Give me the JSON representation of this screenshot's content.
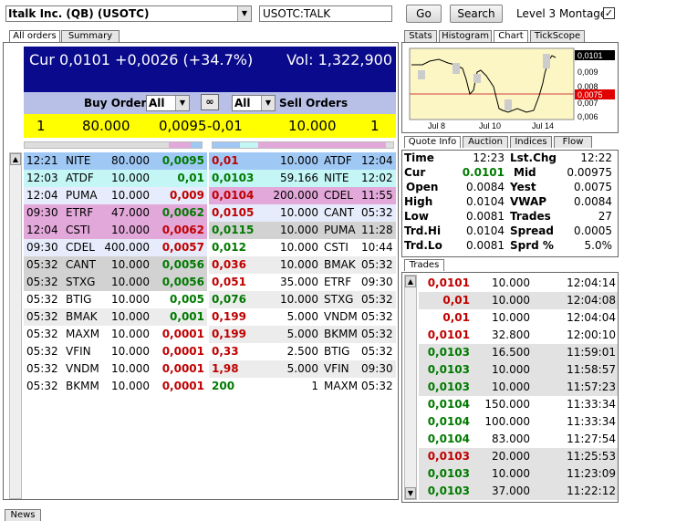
{
  "toolbar": {
    "symbol_combo": "Italk Inc. (QB) (USOTC)",
    "symbol_input": "USOTC:TALK",
    "go_label": "Go",
    "search_label": "Search",
    "level3_label": "Level 3 Montage",
    "level3_checked": "✓"
  },
  "left_tabs": {
    "all_orders": "All orders",
    "summary": "Summary"
  },
  "header": {
    "cur": "Cur 0,0101 +0,0026 (+34.7%)",
    "vol": "Vol: 1,322,900"
  },
  "order_bar": {
    "buy_label": "Buy Orders",
    "buy_filter": "All",
    "sell_filter": "All",
    "sell_label": "Sell Orders"
  },
  "best": {
    "bid_count": "1",
    "bid_size": "80.000",
    "bid_price": "0,0095",
    "ask_price": "-0,01",
    "ask_size": "10.000",
    "ask_count": "1"
  },
  "orders": [
    {
      "bt": "12:21",
      "bm": "NITE",
      "bs": "80.000",
      "bp": "0,0095",
      "bpc": "grn",
      "ap": "0,01",
      "apc": "red",
      "as": "10.000",
      "am": "ATDF",
      "at": "12:04",
      "bbg": "#9fc8f5",
      "abg": "#9fc8f5"
    },
    {
      "bt": "12:03",
      "bm": "ATDF",
      "bs": "10.000",
      "bp": "0,01",
      "bpc": "grn",
      "ap": "0,0103",
      "apc": "grn",
      "as": "59.166",
      "am": "NITE",
      "at": "12:02",
      "bbg": "#c4f6f6",
      "abg": "#c4f6f6"
    },
    {
      "bt": "12:04",
      "bm": "PUMA",
      "bs": "10.000",
      "bp": "0,009",
      "bpc": "red",
      "ap": "0,0104",
      "apc": "red",
      "as": "200.000",
      "am": "CDEL",
      "at": "11:55",
      "bbg": "#e6ecfb",
      "abg": "#e3a8da"
    },
    {
      "bt": "09:30",
      "bm": "ETRF",
      "bs": "47.000",
      "bp": "0,0062",
      "bpc": "grn",
      "ap": "0,0105",
      "apc": "red",
      "as": "10.000",
      "am": "CANT",
      "at": "05:32",
      "bbg": "#e3a8da",
      "abg": "#e6ecfb"
    },
    {
      "bt": "12:04",
      "bm": "CSTI",
      "bs": "10.000",
      "bp": "0,0062",
      "bpc": "red",
      "ap": "0,0115",
      "apc": "grn",
      "as": "10.000",
      "am": "PUMA",
      "at": "11:28",
      "bbg": "#e3a8da",
      "abg": "#d2d2d2"
    },
    {
      "bt": "09:30",
      "bm": "CDEL",
      "bs": "400.000",
      "bp": "0,0057",
      "bpc": "red",
      "ap": "0,012",
      "apc": "grn",
      "as": "10.000",
      "am": "CSTI",
      "at": "10:44",
      "bbg": "#e6ecfb",
      "abg": "#ffffff"
    },
    {
      "bt": "05:32",
      "bm": "CANT",
      "bs": "10.000",
      "bp": "0,0056",
      "bpc": "grn",
      "ap": "0,036",
      "apc": "red",
      "as": "10.000",
      "am": "BMAK",
      "at": "05:32",
      "bbg": "#d2d2d2",
      "abg": "#ececec"
    },
    {
      "bt": "05:32",
      "bm": "STXG",
      "bs": "10.000",
      "bp": "0,0056",
      "bpc": "grn",
      "ap": "0,051",
      "apc": "red",
      "as": "35.000",
      "am": "ETRF",
      "at": "09:30",
      "bbg": "#d2d2d2",
      "abg": "#ffffff"
    },
    {
      "bt": "05:32",
      "bm": "BTIG",
      "bs": "10.000",
      "bp": "0,005",
      "bpc": "grn",
      "ap": "0,076",
      "apc": "grn",
      "as": "10.000",
      "am": "STXG",
      "at": "05:32",
      "bbg": "#ffffff",
      "abg": "#ececec"
    },
    {
      "bt": "05:32",
      "bm": "BMAK",
      "bs": "10.000",
      "bp": "0,001",
      "bpc": "grn",
      "ap": "0,199",
      "apc": "red",
      "as": "5.000",
      "am": "VNDM",
      "at": "05:32",
      "bbg": "#ececec",
      "abg": "#ffffff"
    },
    {
      "bt": "05:32",
      "bm": "MAXM",
      "bs": "10.000",
      "bp": "0,0001",
      "bpc": "red",
      "ap": "0,199",
      "apc": "red",
      "as": "5.000",
      "am": "BKMM",
      "at": "05:32",
      "bbg": "#ffffff",
      "abg": "#ececec"
    },
    {
      "bt": "05:32",
      "bm": "VFIN",
      "bs": "10.000",
      "bp": "0,0001",
      "bpc": "red",
      "ap": "0,33",
      "apc": "red",
      "as": "2.500",
      "am": "BTIG",
      "at": "05:32",
      "bbg": "#ffffff",
      "abg": "#ffffff"
    },
    {
      "bt": "05:32",
      "bm": "VNDM",
      "bs": "10.000",
      "bp": "0,0001",
      "bpc": "red",
      "ap": "1,98",
      "apc": "red",
      "as": "5.000",
      "am": "VFIN",
      "at": "09:30",
      "bbg": "#ffffff",
      "abg": "#ececec"
    },
    {
      "bt": "05:32",
      "bm": "BKMM",
      "bs": "10.000",
      "bp": "0,0001",
      "bpc": "red",
      "ap": "200",
      "apc": "grn",
      "as": "1",
      "am": "MAXM",
      "at": "05:32",
      "bbg": "#ffffff",
      "abg": "#ffffff"
    }
  ],
  "right_tabs": {
    "stats": "Stats",
    "histogram": "Histogram",
    "chart": "Chart",
    "tickscope": "TickScope"
  },
  "chart": {
    "price_labels": [
      "0,0101",
      "0,009",
      "0,008",
      "0,0075",
      "0,007",
      "0,006"
    ],
    "x_labels": [
      "Jul 8",
      "Jul 10",
      "Jul 14"
    ]
  },
  "quote_tabs": {
    "quote_info": "Quote Info",
    "auction": "Auction",
    "indices": "Indices",
    "flow": "Flow"
  },
  "quote": {
    "time_l": "Time",
    "time_v": "12:23",
    "lstchg_l": "Lst.Chg",
    "lstchg_v": "12:22",
    "cur_l": "Cur",
    "cur_v": "0.0101",
    "mid_l": "Mid",
    "mid_v": "0.00975",
    "open_l": "Open",
    "open_v": "0.0084",
    "yest_l": "Yest",
    "yest_v": "0.0075",
    "high_l": "High",
    "high_v": "0.0104",
    "vwap_l": "VWAP",
    "vwap_v": "0.0084",
    "low_l": "Low",
    "low_v": "0.0081",
    "trades_l": "Trades",
    "trades_v": "27",
    "trdhi_l": "Trd.Hi",
    "trdhi_v": "0.0104",
    "spread_l": "Spread",
    "spread_v": "0.0005",
    "trdlo_l": "Trd.Lo",
    "trdlo_v": "0.0081",
    "sprd_l": "Sprd %",
    "sprd_v": "5.0%"
  },
  "trades_tab": "Trades",
  "trades": [
    {
      "p": "0,0101",
      "c": "red",
      "s": "10.000",
      "t": "12:04:14",
      "bg": "#ffffff"
    },
    {
      "p": "0,01",
      "c": "red",
      "s": "10.000",
      "t": "12:04:08",
      "bg": "#e2e2e2"
    },
    {
      "p": "0,01",
      "c": "red",
      "s": "10.000",
      "t": "12:04:04",
      "bg": "#ffffff"
    },
    {
      "p": "0,0101",
      "c": "red",
      "s": "32.800",
      "t": "12:00:10",
      "bg": "#ffffff"
    },
    {
      "p": "0,0103",
      "c": "grn",
      "s": "16.500",
      "t": "11:59:01",
      "bg": "#e2e2e2"
    },
    {
      "p": "0,0103",
      "c": "grn",
      "s": "10.000",
      "t": "11:58:57",
      "bg": "#e2e2e2"
    },
    {
      "p": "0,0103",
      "c": "grn",
      "s": "10.000",
      "t": "11:57:23",
      "bg": "#e2e2e2"
    },
    {
      "p": "0,0104",
      "c": "grn",
      "s": "150.000",
      "t": "11:33:34",
      "bg": "#ffffff"
    },
    {
      "p": "0,0104",
      "c": "grn",
      "s": "100.000",
      "t": "11:33:34",
      "bg": "#ffffff"
    },
    {
      "p": "0,0104",
      "c": "grn",
      "s": "83.000",
      "t": "11:27:54",
      "bg": "#ffffff"
    },
    {
      "p": "0,0103",
      "c": "red",
      "s": "20.000",
      "t": "11:25:53",
      "bg": "#e2e2e2"
    },
    {
      "p": "0,0103",
      "c": "grn",
      "s": "10.000",
      "t": "11:23:09",
      "bg": "#e2e2e2"
    },
    {
      "p": "0,0103",
      "c": "grn",
      "s": "37.000",
      "t": "11:22:12",
      "bg": "#e2e2e2"
    }
  ],
  "bottom_tab": "News"
}
